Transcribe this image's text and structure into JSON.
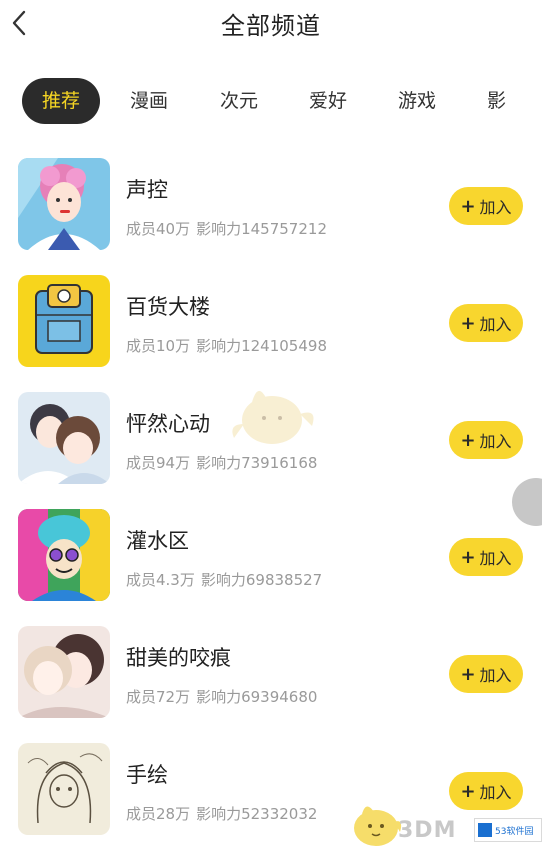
{
  "header": {
    "title": "全部频道",
    "back_icon": "chevron-left-icon"
  },
  "tabs": [
    {
      "label": "推荐",
      "active": true
    },
    {
      "label": "漫画",
      "active": false
    },
    {
      "label": "次元",
      "active": false
    },
    {
      "label": "爱好",
      "active": false
    },
    {
      "label": "游戏",
      "active": false
    },
    {
      "label": "影",
      "active": false
    }
  ],
  "channels": [
    {
      "name": "声控",
      "members": "成员40万",
      "influence": "影响力145757212",
      "join_label": "加入"
    },
    {
      "name": "百货大楼",
      "members": "成员10万",
      "influence": "影响力124105498",
      "join_label": "加入"
    },
    {
      "name": "怦然心动",
      "members": "成员94万",
      "influence": "影响力73916168",
      "join_label": "加入"
    },
    {
      "name": "灌水区",
      "members": "成员4.3万",
      "influence": "影响力69838527",
      "join_label": "加入"
    },
    {
      "name": "甜美的咬痕",
      "members": "成员72万",
      "influence": "影响力69394680",
      "join_label": "加入"
    },
    {
      "name": "手绘",
      "members": "成员28万",
      "influence": "影响力52332032",
      "join_label": "加入"
    }
  ],
  "colors": {
    "accent": "#f8d62e",
    "tab_active_bg": "#2b2b2b",
    "tab_active_text": "#f5d523",
    "muted_text": "#9a9a9a"
  },
  "watermark": {
    "brand": "3DM",
    "site_logo": "53软件园"
  }
}
